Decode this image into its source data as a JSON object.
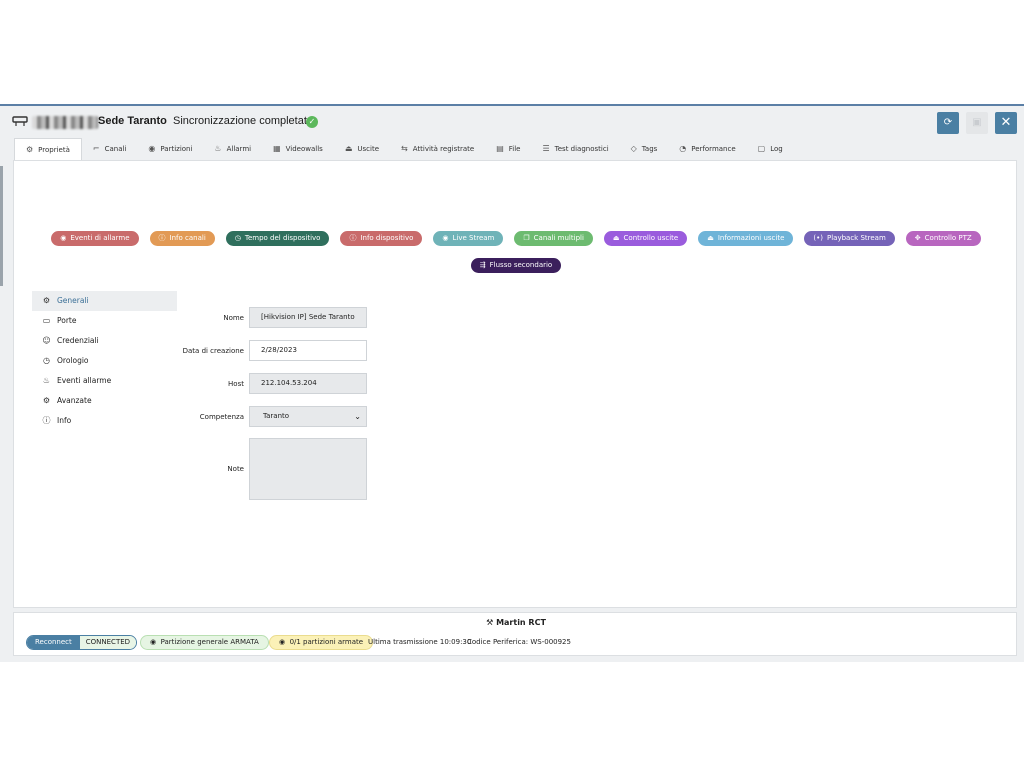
{
  "header": {
    "title": "Sede Taranto",
    "sync_status": "Sincronizzazione completata",
    "buttons": {
      "refresh_icon": "refresh-icon",
      "save_icon": "save-icon",
      "close_icon": "close-icon"
    }
  },
  "tabs": [
    {
      "label": "Proprietà",
      "icon": "gear-icon",
      "active": true
    },
    {
      "label": "Canali",
      "icon": "cctv-icon"
    },
    {
      "label": "Partizioni",
      "icon": "eye-icon"
    },
    {
      "label": "Allarmi",
      "icon": "siren-icon"
    },
    {
      "label": "Videowalls",
      "icon": "grid-icon"
    },
    {
      "label": "Uscite",
      "icon": "output-icon"
    },
    {
      "label": "Attività registrate",
      "icon": "history-icon"
    },
    {
      "label": "File",
      "icon": "file-icon"
    },
    {
      "label": "Test diagnostici",
      "icon": "diagnostics-icon"
    },
    {
      "label": "Tags",
      "icon": "tag-icon"
    },
    {
      "label": "Performance",
      "icon": "gauge-icon"
    },
    {
      "label": "Log",
      "icon": "log-icon"
    }
  ],
  "capabilities": [
    {
      "label": "Eventi di allarme",
      "color": "#c96b6b",
      "icon": "alarm-icon"
    },
    {
      "label": "Info canali",
      "color": "#e29a55",
      "icon": "info-icon"
    },
    {
      "label": "Tempo del dispositivo",
      "color": "#2f6f5d",
      "icon": "clock-icon"
    },
    {
      "label": "Info dispositivo",
      "color": "#c96b6b",
      "icon": "info-icon"
    },
    {
      "label": "Live Stream",
      "color": "#6fb3b8",
      "icon": "eye-icon"
    },
    {
      "label": "Canali multipli",
      "color": "#6dbb70",
      "icon": "layers-icon"
    },
    {
      "label": "Controllo uscite",
      "color": "#9a5cdd",
      "icon": "output-icon"
    },
    {
      "label": "Informazioni uscite",
      "color": "#6fb4d8",
      "icon": "output-icon"
    },
    {
      "label": "Playback Stream",
      "color": "#7563b8",
      "icon": "playback-icon"
    },
    {
      "label": "Controllo PTZ",
      "color": "#b866bf",
      "icon": "move-icon"
    }
  ],
  "capabilities_row2": [
    {
      "label": "Flusso secondario",
      "color": "#3b1f5c",
      "icon": "stream-icon"
    }
  ],
  "sidebar": {
    "items": [
      {
        "label": "Generali",
        "icon": "gear-icon",
        "active": true
      },
      {
        "label": "Porte",
        "icon": "ports-icon"
      },
      {
        "label": "Credenziali",
        "icon": "users-icon"
      },
      {
        "label": "Orologio",
        "icon": "clock-icon"
      },
      {
        "label": "Eventi allarme",
        "icon": "siren-icon"
      },
      {
        "label": "Avanzate",
        "icon": "gear-icon"
      },
      {
        "label": "Info",
        "icon": "info-icon"
      }
    ]
  },
  "form": {
    "nome": {
      "label": "Nome",
      "value": "[Hikvision IP] Sede Taranto"
    },
    "data": {
      "label": "Data di creazione",
      "value": "2/28/2023"
    },
    "host": {
      "label": "Host",
      "value": "212.104.53.204"
    },
    "competenza": {
      "label": "Competenza",
      "value": "Taranto"
    },
    "note": {
      "label": "Note",
      "value": ""
    }
  },
  "footer": {
    "owner": "Martin RCT",
    "reconnect_label": "Reconnect",
    "connection_status": "CONNECTED",
    "partition_badge": "Partizione generale ARMATA",
    "armed_badge": "0/1 partizioni armate",
    "last_transmission": "Ultima trasmissione 10:09:30",
    "device_code": "Codice Periferica: WS-000925"
  }
}
